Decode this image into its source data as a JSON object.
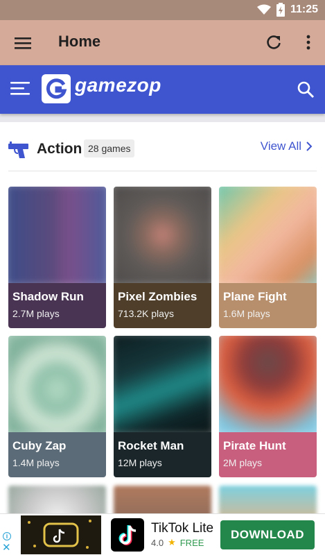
{
  "status_bar": {
    "time": "11:25"
  },
  "app_bar": {
    "title": "Home"
  },
  "gamezop": {
    "logo_text": "gamezop",
    "brand_color": "#3f55cf"
  },
  "section": {
    "title": "Action",
    "count": "28 games",
    "view_all": "View All"
  },
  "games": [
    {
      "name": "Shadow Run",
      "plays": "2.7M plays",
      "info_color": "#4a3454"
    },
    {
      "name": "Pixel Zombies",
      "plays": "713.2K plays",
      "info_color": "#4f3f2a"
    },
    {
      "name": "Plane Fight",
      "plays": "1.6M plays",
      "info_color": "#b78f6c"
    },
    {
      "name": "Cuby Zap",
      "plays": "1.4M plays",
      "info_color": "#5b6b77"
    },
    {
      "name": "Rocket Man",
      "plays": "12M plays",
      "info_color": "#1a262a"
    },
    {
      "name": "Pirate Hunt",
      "plays": "2M plays",
      "info_color": "#c85f7e"
    }
  ],
  "ad": {
    "app_name": "TikTok Lite",
    "rating": "4.0",
    "price": "FREE",
    "cta": "DOWNLOAD"
  },
  "icons": [
    "wifi-icon",
    "battery-icon",
    "hamburger-icon",
    "refresh-icon",
    "more-vert-icon",
    "search-icon",
    "gun-icon",
    "chevron-right-icon",
    "ad-info-icon",
    "close-icon",
    "tiktok-icon",
    "star-icon"
  ]
}
